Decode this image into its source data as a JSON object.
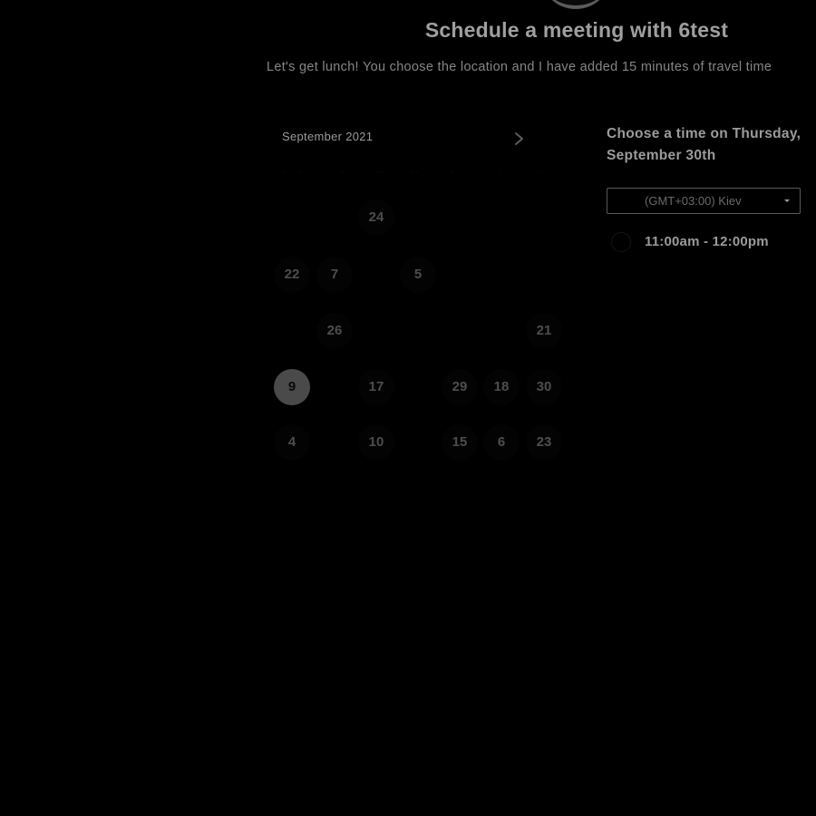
{
  "header": {
    "title": "Schedule a meeting with 6test",
    "subtitle": "Let's get lunch! You choose the location and I have added 15 minutes of travel time"
  },
  "calendar": {
    "month_label": "September 2021",
    "next_icon": "chevron-right-icon",
    "days": [
      {
        "label": "24",
        "row": 0,
        "col": 2
      },
      {
        "label": "22",
        "row": 1,
        "col": 0
      },
      {
        "label": "7",
        "row": 1,
        "col": 1
      },
      {
        "label": "5",
        "row": 1,
        "col": 3
      },
      {
        "label": "26",
        "row": 2,
        "col": 1
      },
      {
        "label": "21",
        "row": 2,
        "col": 6
      },
      {
        "label": "9",
        "row": 3,
        "col": 0,
        "selected": true
      },
      {
        "label": "17",
        "row": 3,
        "col": 2
      },
      {
        "label": "29",
        "row": 3,
        "col": 4
      },
      {
        "label": "18",
        "row": 3,
        "col": 5
      },
      {
        "label": "30",
        "row": 3,
        "col": 6
      },
      {
        "label": "4",
        "row": 4,
        "col": 0
      },
      {
        "label": "10",
        "row": 4,
        "col": 2
      },
      {
        "label": "15",
        "row": 4,
        "col": 4
      },
      {
        "label": "6",
        "row": 4,
        "col": 5
      },
      {
        "label": "23",
        "row": 4,
        "col": 6
      }
    ]
  },
  "time_panel": {
    "choose_title_line1": "Choose a time on Thursday,",
    "choose_title_line2": "September 30th",
    "timezone": {
      "selected": "(GMT+03:00) Kiev",
      "icon": "caret-down-icon"
    },
    "slots": [
      {
        "label": "11:00am - 12:00pm"
      }
    ]
  }
}
